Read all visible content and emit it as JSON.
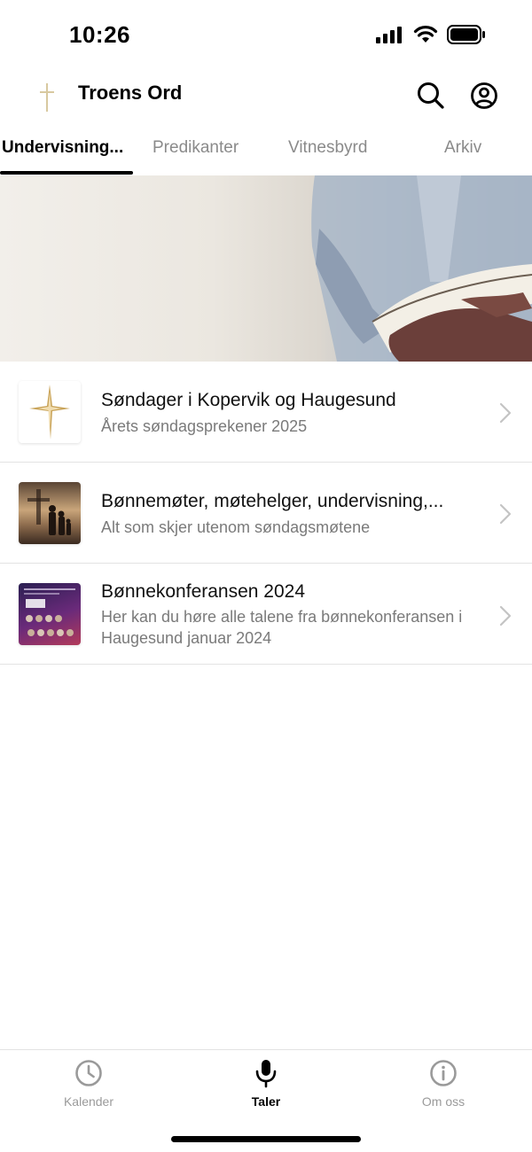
{
  "status_bar": {
    "time": "10:26",
    "icons": [
      "cellular-signal-icon",
      "wifi-icon",
      "battery-icon"
    ]
  },
  "header": {
    "logo_icon": "cross-icon",
    "title": "Troens Ord",
    "actions": [
      "search-icon",
      "account-icon"
    ]
  },
  "tabs": [
    {
      "label": "Undervisning...",
      "active": true
    },
    {
      "label": "Predikanter",
      "active": false
    },
    {
      "label": "Vitnesbyrd",
      "active": false
    },
    {
      "label": "Arkiv",
      "active": false
    }
  ],
  "list": [
    {
      "title": "Søndager i Kopervik og Haugesund",
      "subtitle": "Årets søndagsprekener 2025",
      "thumbnail": "star-cross-image"
    },
    {
      "title": "Bønnemøter, møtehelger, undervisning,...",
      "subtitle": "Alt som skjer utenom søndagsmøtene",
      "thumbnail": "cross-family-sunset-image"
    },
    {
      "title": "Bønnekonferansen 2024",
      "subtitle": "Her kan du høre alle talene fra bønnekonferansen i Haugesund januar 2024",
      "thumbnail": "conference-poster-image"
    }
  ],
  "bottom_nav": [
    {
      "label": "Kalender",
      "icon": "clock-icon",
      "active": false
    },
    {
      "label": "Taler",
      "icon": "microphone-icon",
      "active": true
    },
    {
      "label": "Om oss",
      "icon": "info-icon",
      "active": false
    }
  ],
  "colors": {
    "active": "#000000",
    "inactive": "#8a8a8a",
    "divider": "#e3e3e3",
    "background": "#ffffff"
  }
}
